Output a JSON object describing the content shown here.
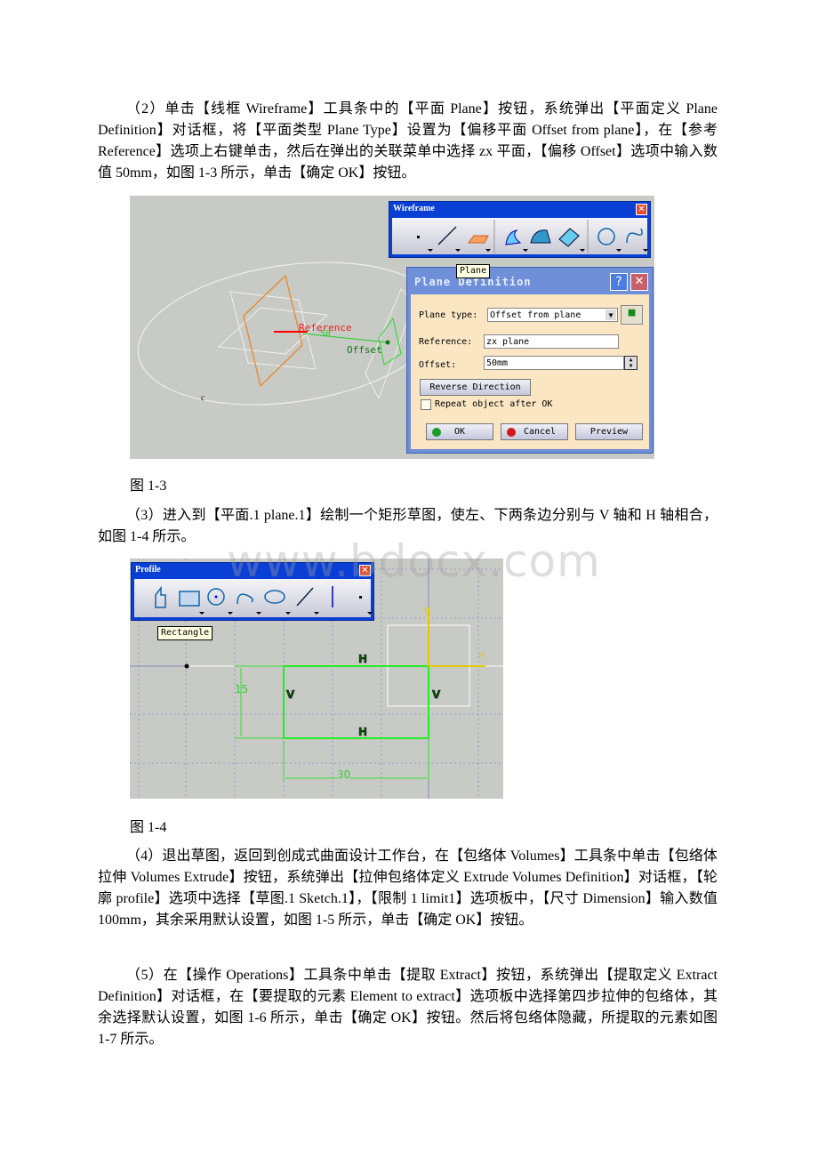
{
  "paragraphs": [
    "（2）单击【线框 Wireframe】工具条中的【平面 Plane】按钮，系统弹出【平面定义 Plane Definition】对话框，将【平面类型 Plane Type】设置为【偏移平面 Offset from plane】，在【参考 Reference】选项上右键单击，然后在弹出的关联菜单中选择 zx 平面，【偏移 Offset】选项中输入数值 50mm，如图 1-3 所示，单击【确定 OK】按钮。",
    "（3）进入到【平面.1 plane.1】绘制一个矩形草图，使左、下两条边分别与 V 轴和 H 轴相合，如图 1-4 所示。",
    "（4）退出草图，返回到创成式曲面设计工作台，在【包络体 Volumes】工具条中单击【包络体拉伸 Volumes Extrude】按钮，系统弹出【拉伸包络体定义 Extrude Volumes Definition】对话框，【轮廓 profile】选项中选择【草图.1 Sketch.1】，【限制 1 limit1】选项板中，【尺寸 Dimension】输入数值 100mm，其余采用默认设置，如图 1-5 所示，单击【确定 OK】按钮。",
    "（5）在【操作 Operations】工具条中单击【提取 Extract】按钮，系统弹出【提取定义 Extract Definition】对话框，在【要提取的元素 Element to extract】选项板中选择第四步拉伸的包络体，其余选择默认设置，如图 1-6 所示，单击【确定 OK】按钮。然后将包络体隐藏，所提取的元素如图 1-7 所示。"
  ],
  "captions": [
    "图 1-3",
    "图 1-4"
  ],
  "watermark": "www.bdocx.com",
  "fig3": {
    "toolbar_title": "Wireframe",
    "tooltip": "Plane",
    "labels": {
      "reference": "Reference",
      "offset": "Offset",
      "offset_value": "50"
    },
    "dialog": {
      "title": "Plane Definition",
      "plane_type_label": "Plane type:",
      "plane_type_value": "Offset from plane",
      "reference_label": "Reference:",
      "reference_value": "zx plane",
      "offset_label": "Offset:",
      "offset_value": "50mm",
      "reverse_label": "Reverse Direction",
      "repeat_label": "Repeat object after OK",
      "repeat_checked": false,
      "ok": "OK",
      "cancel": "Cancel",
      "preview": "Preview",
      "help": "?",
      "close": "✕"
    }
  },
  "fig4": {
    "toolbar_title": "Profile",
    "tooltip": "Rectangle",
    "constraints": {
      "h": "H",
      "v": "V"
    },
    "dims": {
      "height": "15",
      "width": "30"
    },
    "axes": {
      "v": "V",
      "h": "H"
    }
  }
}
